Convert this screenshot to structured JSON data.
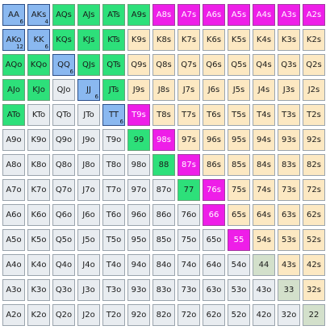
{
  "colors": {
    "blue": "#8ab8f0",
    "green": "#2de07a",
    "magenta": "#ee1ee8",
    "sage": "#d3e0cb",
    "suited_default": "#fce8c2",
    "offsuit_default": "#e8ecf0"
  },
  "grid": {
    "rows": [
      [
        {
          "label": "AA",
          "color": "blue",
          "count": "6"
        },
        {
          "label": "AKs",
          "color": "blue",
          "count": "4"
        },
        {
          "label": "AQs",
          "color": "green"
        },
        {
          "label": "AJs",
          "color": "green"
        },
        {
          "label": "ATs",
          "color": "green"
        },
        {
          "label": "A9s",
          "color": "green"
        },
        {
          "label": "A8s",
          "color": "magenta"
        },
        {
          "label": "A7s",
          "color": "magenta"
        },
        {
          "label": "A6s",
          "color": "magenta"
        },
        {
          "label": "A5s",
          "color": "magenta"
        },
        {
          "label": "A4s",
          "color": "magenta"
        },
        {
          "label": "A3s",
          "color": "magenta"
        },
        {
          "label": "A2s",
          "color": "magenta"
        }
      ],
      [
        {
          "label": "AKo",
          "color": "blue",
          "count": "12"
        },
        {
          "label": "KK",
          "color": "blue",
          "count": "6"
        },
        {
          "label": "KQs",
          "color": "green"
        },
        {
          "label": "KJs",
          "color": "green"
        },
        {
          "label": "KTs",
          "color": "green"
        },
        {
          "label": "K9s",
          "color": "none"
        },
        {
          "label": "K8s",
          "color": "none"
        },
        {
          "label": "K7s",
          "color": "none"
        },
        {
          "label": "K6s",
          "color": "none"
        },
        {
          "label": "K5s",
          "color": "none"
        },
        {
          "label": "K4s",
          "color": "none"
        },
        {
          "label": "K3s",
          "color": "none"
        },
        {
          "label": "K2s",
          "color": "none"
        }
      ],
      [
        {
          "label": "AQo",
          "color": "green"
        },
        {
          "label": "KQo",
          "color": "green"
        },
        {
          "label": "QQ",
          "color": "blue",
          "count": "6"
        },
        {
          "label": "QJs",
          "color": "green"
        },
        {
          "label": "QTs",
          "color": "green"
        },
        {
          "label": "Q9s",
          "color": "none"
        },
        {
          "label": "Q8s",
          "color": "none"
        },
        {
          "label": "Q7s",
          "color": "none"
        },
        {
          "label": "Q6s",
          "color": "none"
        },
        {
          "label": "Q5s",
          "color": "none"
        },
        {
          "label": "Q4s",
          "color": "none"
        },
        {
          "label": "Q3s",
          "color": "none"
        },
        {
          "label": "Q2s",
          "color": "none"
        }
      ],
      [
        {
          "label": "AJo",
          "color": "green"
        },
        {
          "label": "KJo",
          "color": "green"
        },
        {
          "label": "QJo",
          "color": "none"
        },
        {
          "label": "JJ",
          "color": "blue",
          "count": "6"
        },
        {
          "label": "JTs",
          "color": "green"
        },
        {
          "label": "J9s",
          "color": "none"
        },
        {
          "label": "J8s",
          "color": "none"
        },
        {
          "label": "J7s",
          "color": "none"
        },
        {
          "label": "J6s",
          "color": "none"
        },
        {
          "label": "J5s",
          "color": "none"
        },
        {
          "label": "J4s",
          "color": "none"
        },
        {
          "label": "J3s",
          "color": "none"
        },
        {
          "label": "J2s",
          "color": "none"
        }
      ],
      [
        {
          "label": "ATo",
          "color": "green"
        },
        {
          "label": "KTo",
          "color": "none"
        },
        {
          "label": "QTo",
          "color": "none"
        },
        {
          "label": "JTo",
          "color": "none"
        },
        {
          "label": "TT",
          "color": "blue",
          "count": "6"
        },
        {
          "label": "T9s",
          "color": "magenta"
        },
        {
          "label": "T8s",
          "color": "none"
        },
        {
          "label": "T7s",
          "color": "none"
        },
        {
          "label": "T6s",
          "color": "none"
        },
        {
          "label": "T5s",
          "color": "none"
        },
        {
          "label": "T4s",
          "color": "none"
        },
        {
          "label": "T3s",
          "color": "none"
        },
        {
          "label": "T2s",
          "color": "none"
        }
      ],
      [
        {
          "label": "A9o",
          "color": "none"
        },
        {
          "label": "K9o",
          "color": "none"
        },
        {
          "label": "Q9o",
          "color": "none"
        },
        {
          "label": "J9o",
          "color": "none"
        },
        {
          "label": "T9o",
          "color": "none"
        },
        {
          "label": "99",
          "color": "green"
        },
        {
          "label": "98s",
          "color": "magenta"
        },
        {
          "label": "97s",
          "color": "none"
        },
        {
          "label": "96s",
          "color": "none"
        },
        {
          "label": "95s",
          "color": "none"
        },
        {
          "label": "94s",
          "color": "none"
        },
        {
          "label": "93s",
          "color": "none"
        },
        {
          "label": "92s",
          "color": "none"
        }
      ],
      [
        {
          "label": "A8o",
          "color": "none"
        },
        {
          "label": "K8o",
          "color": "none"
        },
        {
          "label": "Q8o",
          "color": "none"
        },
        {
          "label": "J8o",
          "color": "none"
        },
        {
          "label": "T8o",
          "color": "none"
        },
        {
          "label": "98o",
          "color": "none"
        },
        {
          "label": "88",
          "color": "green"
        },
        {
          "label": "87s",
          "color": "magenta"
        },
        {
          "label": "86s",
          "color": "none"
        },
        {
          "label": "85s",
          "color": "none"
        },
        {
          "label": "84s",
          "color": "none"
        },
        {
          "label": "83s",
          "color": "none"
        },
        {
          "label": "82s",
          "color": "none"
        }
      ],
      [
        {
          "label": "A7o",
          "color": "none"
        },
        {
          "label": "K7o",
          "color": "none"
        },
        {
          "label": "Q7o",
          "color": "none"
        },
        {
          "label": "J7o",
          "color": "none"
        },
        {
          "label": "T7o",
          "color": "none"
        },
        {
          "label": "97o",
          "color": "none"
        },
        {
          "label": "87o",
          "color": "none"
        },
        {
          "label": "77",
          "color": "green"
        },
        {
          "label": "76s",
          "color": "magenta"
        },
        {
          "label": "75s",
          "color": "none"
        },
        {
          "label": "74s",
          "color": "none"
        },
        {
          "label": "73s",
          "color": "none"
        },
        {
          "label": "72s",
          "color": "none"
        }
      ],
      [
        {
          "label": "A6o",
          "color": "none"
        },
        {
          "label": "K6o",
          "color": "none"
        },
        {
          "label": "Q6o",
          "color": "none"
        },
        {
          "label": "J6o",
          "color": "none"
        },
        {
          "label": "T6o",
          "color": "none"
        },
        {
          "label": "96o",
          "color": "none"
        },
        {
          "label": "86o",
          "color": "none"
        },
        {
          "label": "76o",
          "color": "none"
        },
        {
          "label": "66",
          "color": "magenta"
        },
        {
          "label": "65s",
          "color": "none"
        },
        {
          "label": "64s",
          "color": "none"
        },
        {
          "label": "63s",
          "color": "none"
        },
        {
          "label": "62s",
          "color": "none"
        }
      ],
      [
        {
          "label": "A5o",
          "color": "none"
        },
        {
          "label": "K5o",
          "color": "none"
        },
        {
          "label": "Q5o",
          "color": "none"
        },
        {
          "label": "J5o",
          "color": "none"
        },
        {
          "label": "T5o",
          "color": "none"
        },
        {
          "label": "95o",
          "color": "none"
        },
        {
          "label": "85o",
          "color": "none"
        },
        {
          "label": "75o",
          "color": "none"
        },
        {
          "label": "65o",
          "color": "none"
        },
        {
          "label": "55",
          "color": "magenta"
        },
        {
          "label": "54s",
          "color": "none"
        },
        {
          "label": "53s",
          "color": "none"
        },
        {
          "label": "52s",
          "color": "none"
        }
      ],
      [
        {
          "label": "A4o",
          "color": "none"
        },
        {
          "label": "K4o",
          "color": "none"
        },
        {
          "label": "Q4o",
          "color": "none"
        },
        {
          "label": "J4o",
          "color": "none"
        },
        {
          "label": "T4o",
          "color": "none"
        },
        {
          "label": "94o",
          "color": "none"
        },
        {
          "label": "84o",
          "color": "none"
        },
        {
          "label": "74o",
          "color": "none"
        },
        {
          "label": "64o",
          "color": "none"
        },
        {
          "label": "54o",
          "color": "none"
        },
        {
          "label": "44",
          "color": "sage"
        },
        {
          "label": "43s",
          "color": "none"
        },
        {
          "label": "42s",
          "color": "none"
        }
      ],
      [
        {
          "label": "A3o",
          "color": "none"
        },
        {
          "label": "K3o",
          "color": "none"
        },
        {
          "label": "Q3o",
          "color": "none"
        },
        {
          "label": "J3o",
          "color": "none"
        },
        {
          "label": "T3o",
          "color": "none"
        },
        {
          "label": "93o",
          "color": "none"
        },
        {
          "label": "83o",
          "color": "none"
        },
        {
          "label": "73o",
          "color": "none"
        },
        {
          "label": "63o",
          "color": "none"
        },
        {
          "label": "53o",
          "color": "none"
        },
        {
          "label": "43o",
          "color": "none"
        },
        {
          "label": "33",
          "color": "sage"
        },
        {
          "label": "32s",
          "color": "none"
        }
      ],
      [
        {
          "label": "A2o",
          "color": "none"
        },
        {
          "label": "K2o",
          "color": "none"
        },
        {
          "label": "Q2o",
          "color": "none"
        },
        {
          "label": "J2o",
          "color": "none"
        },
        {
          "label": "T2o",
          "color": "none"
        },
        {
          "label": "92o",
          "color": "none"
        },
        {
          "label": "82o",
          "color": "none"
        },
        {
          "label": "72o",
          "color": "none"
        },
        {
          "label": "62o",
          "color": "none"
        },
        {
          "label": "52o",
          "color": "none"
        },
        {
          "label": "42o",
          "color": "none"
        },
        {
          "label": "32o",
          "color": "none"
        },
        {
          "label": "22",
          "color": "sage"
        }
      ]
    ]
  }
}
